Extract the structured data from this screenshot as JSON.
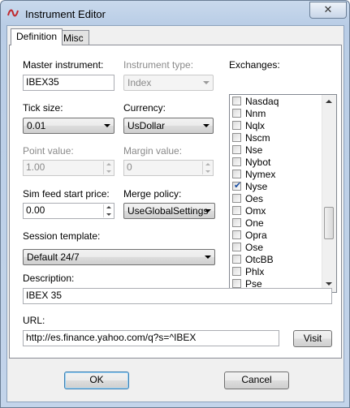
{
  "window": {
    "title": "Instrument Editor",
    "close_glyph": "✕"
  },
  "tabs": [
    {
      "label": "Definition",
      "active": true
    },
    {
      "label": "Misc",
      "active": false
    }
  ],
  "fields": {
    "master_instrument": {
      "label": "Master instrument:",
      "value": "IBEX35"
    },
    "instrument_type": {
      "label": "Instrument type:",
      "value": "Index",
      "enabled": false
    },
    "tick_size": {
      "label": "Tick size:",
      "value": "0.01"
    },
    "currency": {
      "label": "Currency:",
      "value": "UsDollar"
    },
    "point_value": {
      "label": "Point value:",
      "value": "1.00",
      "enabled": false
    },
    "margin_value": {
      "label": "Margin value:",
      "value": "0",
      "enabled": false
    },
    "sim_feed_start_price": {
      "label": "Sim feed start price:",
      "value": "0.00"
    },
    "merge_policy": {
      "label": "Merge policy:",
      "value": "UseGlobalSettings"
    },
    "session_template": {
      "label": "Session template:",
      "value": "Default 24/7"
    },
    "description": {
      "label": "Description:",
      "value": "IBEX 35"
    },
    "url": {
      "label": "URL:",
      "value": "http://es.finance.yahoo.com/q?s=^IBEX"
    }
  },
  "exchanges": {
    "label": "Exchanges:",
    "items": [
      {
        "name": "Nasdaq",
        "checked": false
      },
      {
        "name": "Nnm",
        "checked": false
      },
      {
        "name": "Nqlx",
        "checked": false
      },
      {
        "name": "Nscm",
        "checked": false
      },
      {
        "name": "Nse",
        "checked": false
      },
      {
        "name": "Nybot",
        "checked": false
      },
      {
        "name": "Nymex",
        "checked": false
      },
      {
        "name": "Nyse",
        "checked": true
      },
      {
        "name": "Oes",
        "checked": false
      },
      {
        "name": "Omx",
        "checked": false
      },
      {
        "name": "One",
        "checked": false
      },
      {
        "name": "Opra",
        "checked": false
      },
      {
        "name": "Ose",
        "checked": false
      },
      {
        "name": "OtcBB",
        "checked": false
      },
      {
        "name": "Phlx",
        "checked": false
      },
      {
        "name": "Pse",
        "checked": false
      }
    ]
  },
  "buttons": {
    "visit": "Visit",
    "ok": "OK",
    "cancel": "Cancel"
  },
  "colors": {
    "title_gradient_top": "#c9d9ec",
    "panel_bg": "#f0f0f0",
    "check_color": "#1a4ea3"
  }
}
